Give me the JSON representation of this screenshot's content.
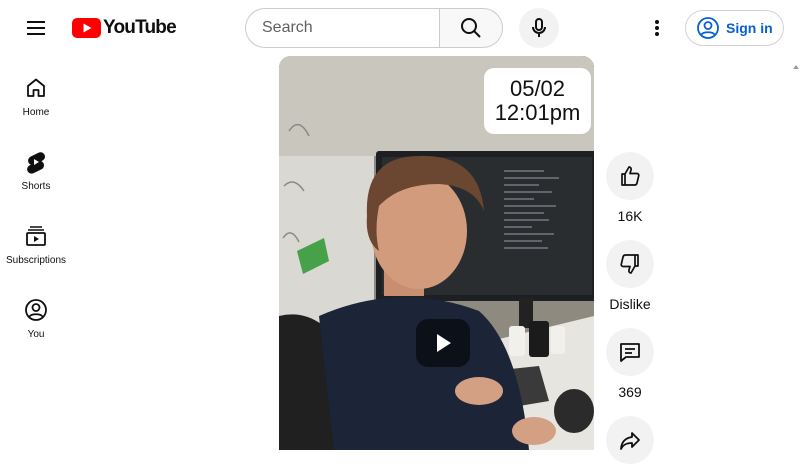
{
  "header": {
    "logo_text": "YouTube",
    "search_placeholder": "Search",
    "signin_label": "Sign in",
    "icons": [
      "menu-icon",
      "youtube-logo-icon",
      "search-icon",
      "mic-icon",
      "more-vert-icon",
      "account-circle-icon"
    ],
    "brand_color": "#ff0000",
    "link_color": "#065fd4"
  },
  "sidebar": {
    "items": [
      {
        "label": "Home",
        "icon": "home-icon"
      },
      {
        "label": "Shorts",
        "icon": "shorts-icon"
      },
      {
        "label": "Subscriptions",
        "icon": "subscriptions-icon"
      },
      {
        "label": "You",
        "icon": "you-icon"
      }
    ]
  },
  "video": {
    "overlay_date": "05/02",
    "overlay_time": "12:01pm",
    "play_icon": "play-icon"
  },
  "actions": {
    "like_count": "16K",
    "dislike_label": "Dislike",
    "comment_count": "369",
    "icons": [
      "thumbs-up-icon",
      "thumbs-down-icon",
      "comment-icon",
      "share-icon"
    ]
  }
}
